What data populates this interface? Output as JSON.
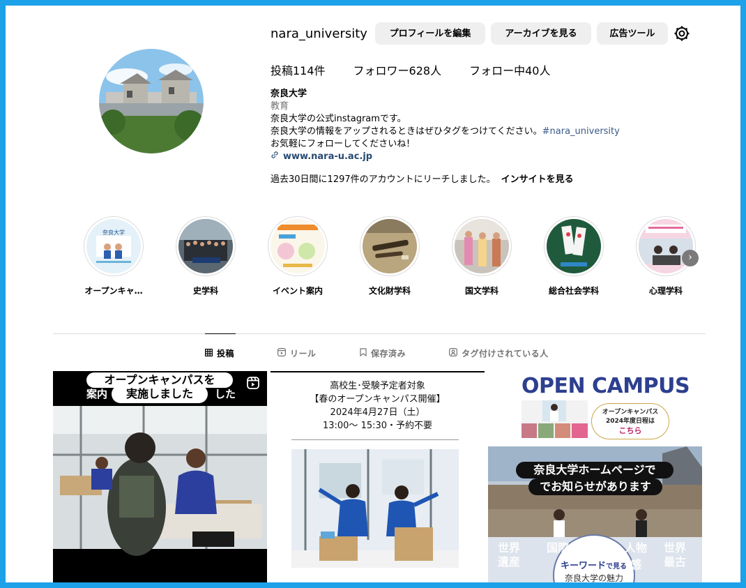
{
  "profile": {
    "username": "nara_university",
    "buttons": {
      "edit": "プロフィールを編集",
      "archive": "アーカイブを見る",
      "ads": "広告ツール"
    },
    "stats": {
      "posts": "投稿114件",
      "followers": "フォロワー628人",
      "following": "フォロー中40人"
    },
    "name": "奈良大学",
    "category": "教育",
    "bio_line1": "奈良大学の公式instagramです。",
    "bio_line2": "奈良大学の情報をアップされるときはぜひタグをつけてください。",
    "bio_hashtag": "#nara_university",
    "bio_line3": "お気軽にフォローしてくださいね！",
    "link": "www.nara-u.ac.jp",
    "reach": "過去30日間に1297件のアカウントにリーチしました。",
    "insight": "インサイトを見る"
  },
  "highlights": [
    {
      "label": "オープンキャ…",
      "img_text": "奈良大学"
    },
    {
      "label": "史学科"
    },
    {
      "label": "イベント案内"
    },
    {
      "label": "文化財学科"
    },
    {
      "label": "国文学科"
    },
    {
      "label": "総合社会学科"
    },
    {
      "label": "心理学科"
    }
  ],
  "tabs": {
    "posts": "投稿",
    "reels": "リール",
    "saved": "保存済み",
    "tagged": "タグ付けされている人"
  },
  "posts": {
    "p1": {
      "caption_top": "オープンキャンパスを",
      "caption_bottom": "実施しました",
      "behind_left": "案内",
      "behind_right": "した"
    },
    "p2": {
      "line1": "高校生･受験予定者対象",
      "line2": "【春のオープンキャンパス開催】",
      "line3": "2024年4月27日（土）",
      "line4": "13:00～ 15:30・予約不要"
    },
    "p3": {
      "brand": "OPEN CAMPUS",
      "badge_line1": "オープンキャンパス",
      "badge_line2": "2024年度日程は",
      "badge_line3": "こちら",
      "notice_line1": "奈良大学ホームページで",
      "notice_line2": "でお知らせがあります",
      "kw_line1": "キーワード",
      "kw_suffix": "で見る",
      "kw_line2": "奈良大学の魅力",
      "bg_words": [
        "世界",
        "遺産",
        "国際",
        "人物",
        "感",
        "世界",
        "最古"
      ]
    }
  },
  "colors": {
    "frame": "#1da1e8",
    "link": "#264a73",
    "hashtag": "#3a5a8a",
    "oc_blue": "#2d3f8f",
    "accent_pink": "#c0206a"
  }
}
